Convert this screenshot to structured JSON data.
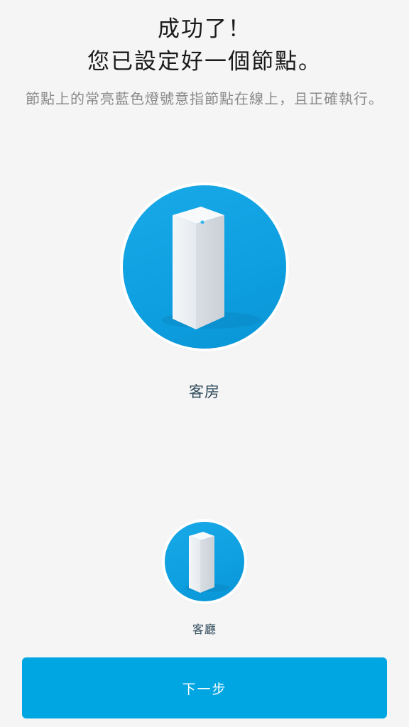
{
  "header": {
    "title_line1": "成功了！",
    "title_line2": "您已設定好一個節點。",
    "subtitle": "節點上的常亮藍色燈號意指節點在線上，且正確執行。"
  },
  "nodes": [
    {
      "label": "客房",
      "icon": "router-node-icon"
    },
    {
      "label": "客廳",
      "icon": "router-node-icon"
    }
  ],
  "footer": {
    "next_label": "下一步"
  },
  "colors": {
    "background": "#f5f5f5",
    "accent": "#00a6e2",
    "circle_blue": "#0d9fe0",
    "label_text": "#2f4a5a"
  }
}
